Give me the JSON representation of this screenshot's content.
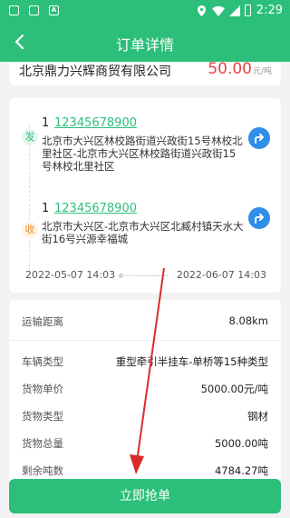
{
  "status_bar": {
    "time": "2:29",
    "notification_icon_letter": "A"
  },
  "header": {
    "title": "订单详情"
  },
  "company": {
    "name": "北京鼎力兴辉商贸有限公司",
    "price": "50.00",
    "price_unit": "元/吨"
  },
  "route": {
    "sender": {
      "tag": "发",
      "name": "1",
      "phone": "12345678900",
      "address": "北京市大兴区林校路街道兴政街15号林校北里社区-北京市大兴区林校路街道兴政街15号林校北里社区"
    },
    "receiver": {
      "tag": "收",
      "name": "1",
      "phone": "12345678900",
      "address": "北京市大兴区-北京市大兴区北臧村镇天水大街16号兴源幸福城"
    },
    "load_date": "2022-05-07 14:03",
    "unload_date": "2022-06-07 14:03"
  },
  "details": [
    {
      "label": "运输距离",
      "value": "8.08km"
    },
    {
      "label": "车辆类型",
      "value": "重型牵引半挂车-单桥等15种类型"
    },
    {
      "label": "货物单价",
      "value": "5000.00元/吨"
    },
    {
      "label": "货物类型",
      "value": "钢材"
    },
    {
      "label": "货物总量",
      "value": "5000.00吨"
    },
    {
      "label": "剩余吨数",
      "value": "4784.27吨"
    }
  ],
  "action": {
    "grab_label": "立即抢单"
  },
  "colors": {
    "brand": "#2cbf7a",
    "price": "#e64340",
    "nav_button": "#2f8fe6",
    "annotation_arrow": "#d92b2b"
  }
}
